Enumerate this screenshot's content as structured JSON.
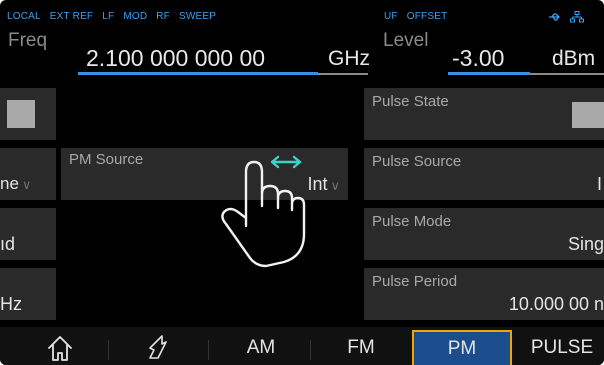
{
  "status_bar": {
    "left_items": [
      "LOCAL",
      "EXT REF",
      "LF",
      "MOD",
      "RF",
      "SWEEP"
    ],
    "right_items": [
      "UF",
      "OFFSET"
    ],
    "icons": [
      "usb-icon",
      "network-icon"
    ]
  },
  "freq": {
    "label": "Freq",
    "value": "2.100 000 000 00",
    "unit": "GHz"
  },
  "level": {
    "label": "Level",
    "value": "-3.00",
    "unit": "dBm"
  },
  "left_column": {
    "row2_value": "ne",
    "row3_value": "ıd",
    "row4_value": "Hz"
  },
  "pm_source": {
    "title": "PM Source",
    "value": "Int"
  },
  "pulse": {
    "state_title": "Pulse State",
    "source_title": "Pulse Source",
    "source_value": "I",
    "mode_title": "Pulse Mode",
    "mode_value": "Sing",
    "period_title": "Pulse Period",
    "period_value": "10.000 00 n"
  },
  "gesture": {
    "hint": "swipe-horizontal"
  },
  "bottom_tabs": {
    "am": "AM",
    "fm": "FM",
    "pm": "PM",
    "pulse": "PULSE",
    "active": "PM"
  },
  "colors": {
    "accent_blue": "#3a8fe0",
    "status_blue": "#3aa0f0",
    "active_tab_border": "#f0a500",
    "active_tab_bg": "#1b4d8c",
    "swipe_arrow": "#3fd1c5"
  }
}
